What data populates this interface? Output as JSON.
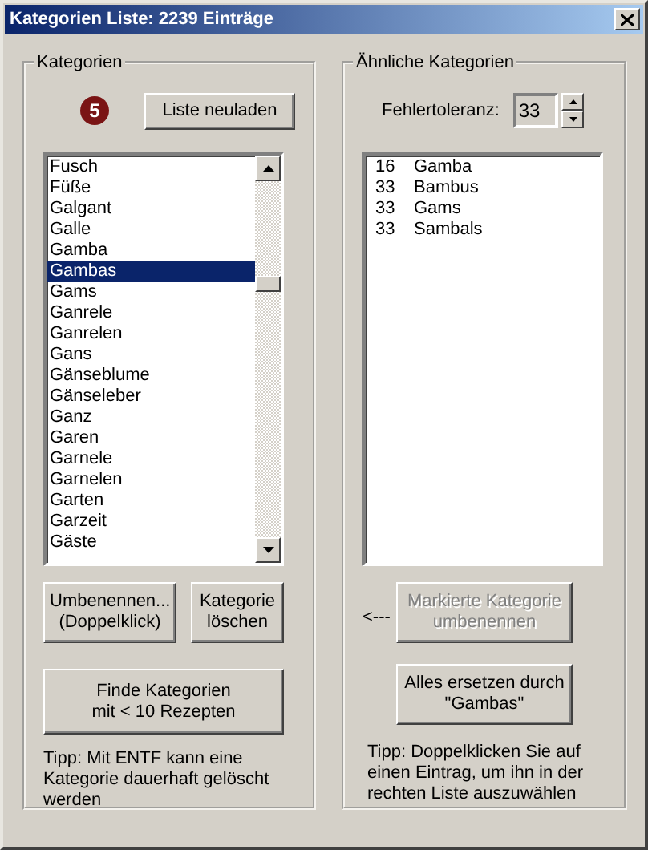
{
  "window": {
    "title": "Kategorien Liste: 2239 Einträge"
  },
  "left": {
    "legend": "Kategorien",
    "badge": "5",
    "reload_button": "Liste neuladen",
    "items": [
      {
        "label": "Fusch",
        "selected": false
      },
      {
        "label": "Füße",
        "selected": false
      },
      {
        "label": "Galgant",
        "selected": false
      },
      {
        "label": "Galle",
        "selected": false
      },
      {
        "label": "Gamba",
        "selected": false
      },
      {
        "label": "Gambas",
        "selected": true
      },
      {
        "label": "Gams",
        "selected": false
      },
      {
        "label": "Ganrele",
        "selected": false
      },
      {
        "label": "Ganrelen",
        "selected": false
      },
      {
        "label": "Gans",
        "selected": false
      },
      {
        "label": "Gänseblume",
        "selected": false
      },
      {
        "label": "Gänseleber",
        "selected": false
      },
      {
        "label": "Ganz",
        "selected": false
      },
      {
        "label": "Garen",
        "selected": false
      },
      {
        "label": "Garnele",
        "selected": false
      },
      {
        "label": "Garnelen",
        "selected": false
      },
      {
        "label": "Garten",
        "selected": false
      },
      {
        "label": "Garzeit",
        "selected": false
      },
      {
        "label": "Gäste",
        "selected": false
      }
    ],
    "rename_button": "Umbenennen...\n(Doppelklick)",
    "delete_button": "Kategorie\nlöschen",
    "find_button": "Finde Kategorien\nmit < 10 Rezepten",
    "tip": "Tipp: Mit ENTF kann eine Kategorie dauerhaft gelöscht werden"
  },
  "right": {
    "legend": "Ähnliche Kategorien",
    "tolerance_label": "Fehlertoleranz:",
    "tolerance_value": "33",
    "matches": [
      {
        "score": "16",
        "name": "Gamba"
      },
      {
        "score": "33",
        "name": "Bambus"
      },
      {
        "score": "33",
        "name": "Gams"
      },
      {
        "score": "33",
        "name": "Sambals"
      }
    ],
    "arrow": "<---",
    "rename_button": {
      "label": "Markierte Kategorie\numbenennen",
      "disabled": true
    },
    "replace_button": "Alles ersetzen durch\n\"Gambas\"",
    "tip": "Tipp: Doppelklicken Sie auf einen Eintrag, um ihn in der rechten Liste auszuwählen"
  }
}
